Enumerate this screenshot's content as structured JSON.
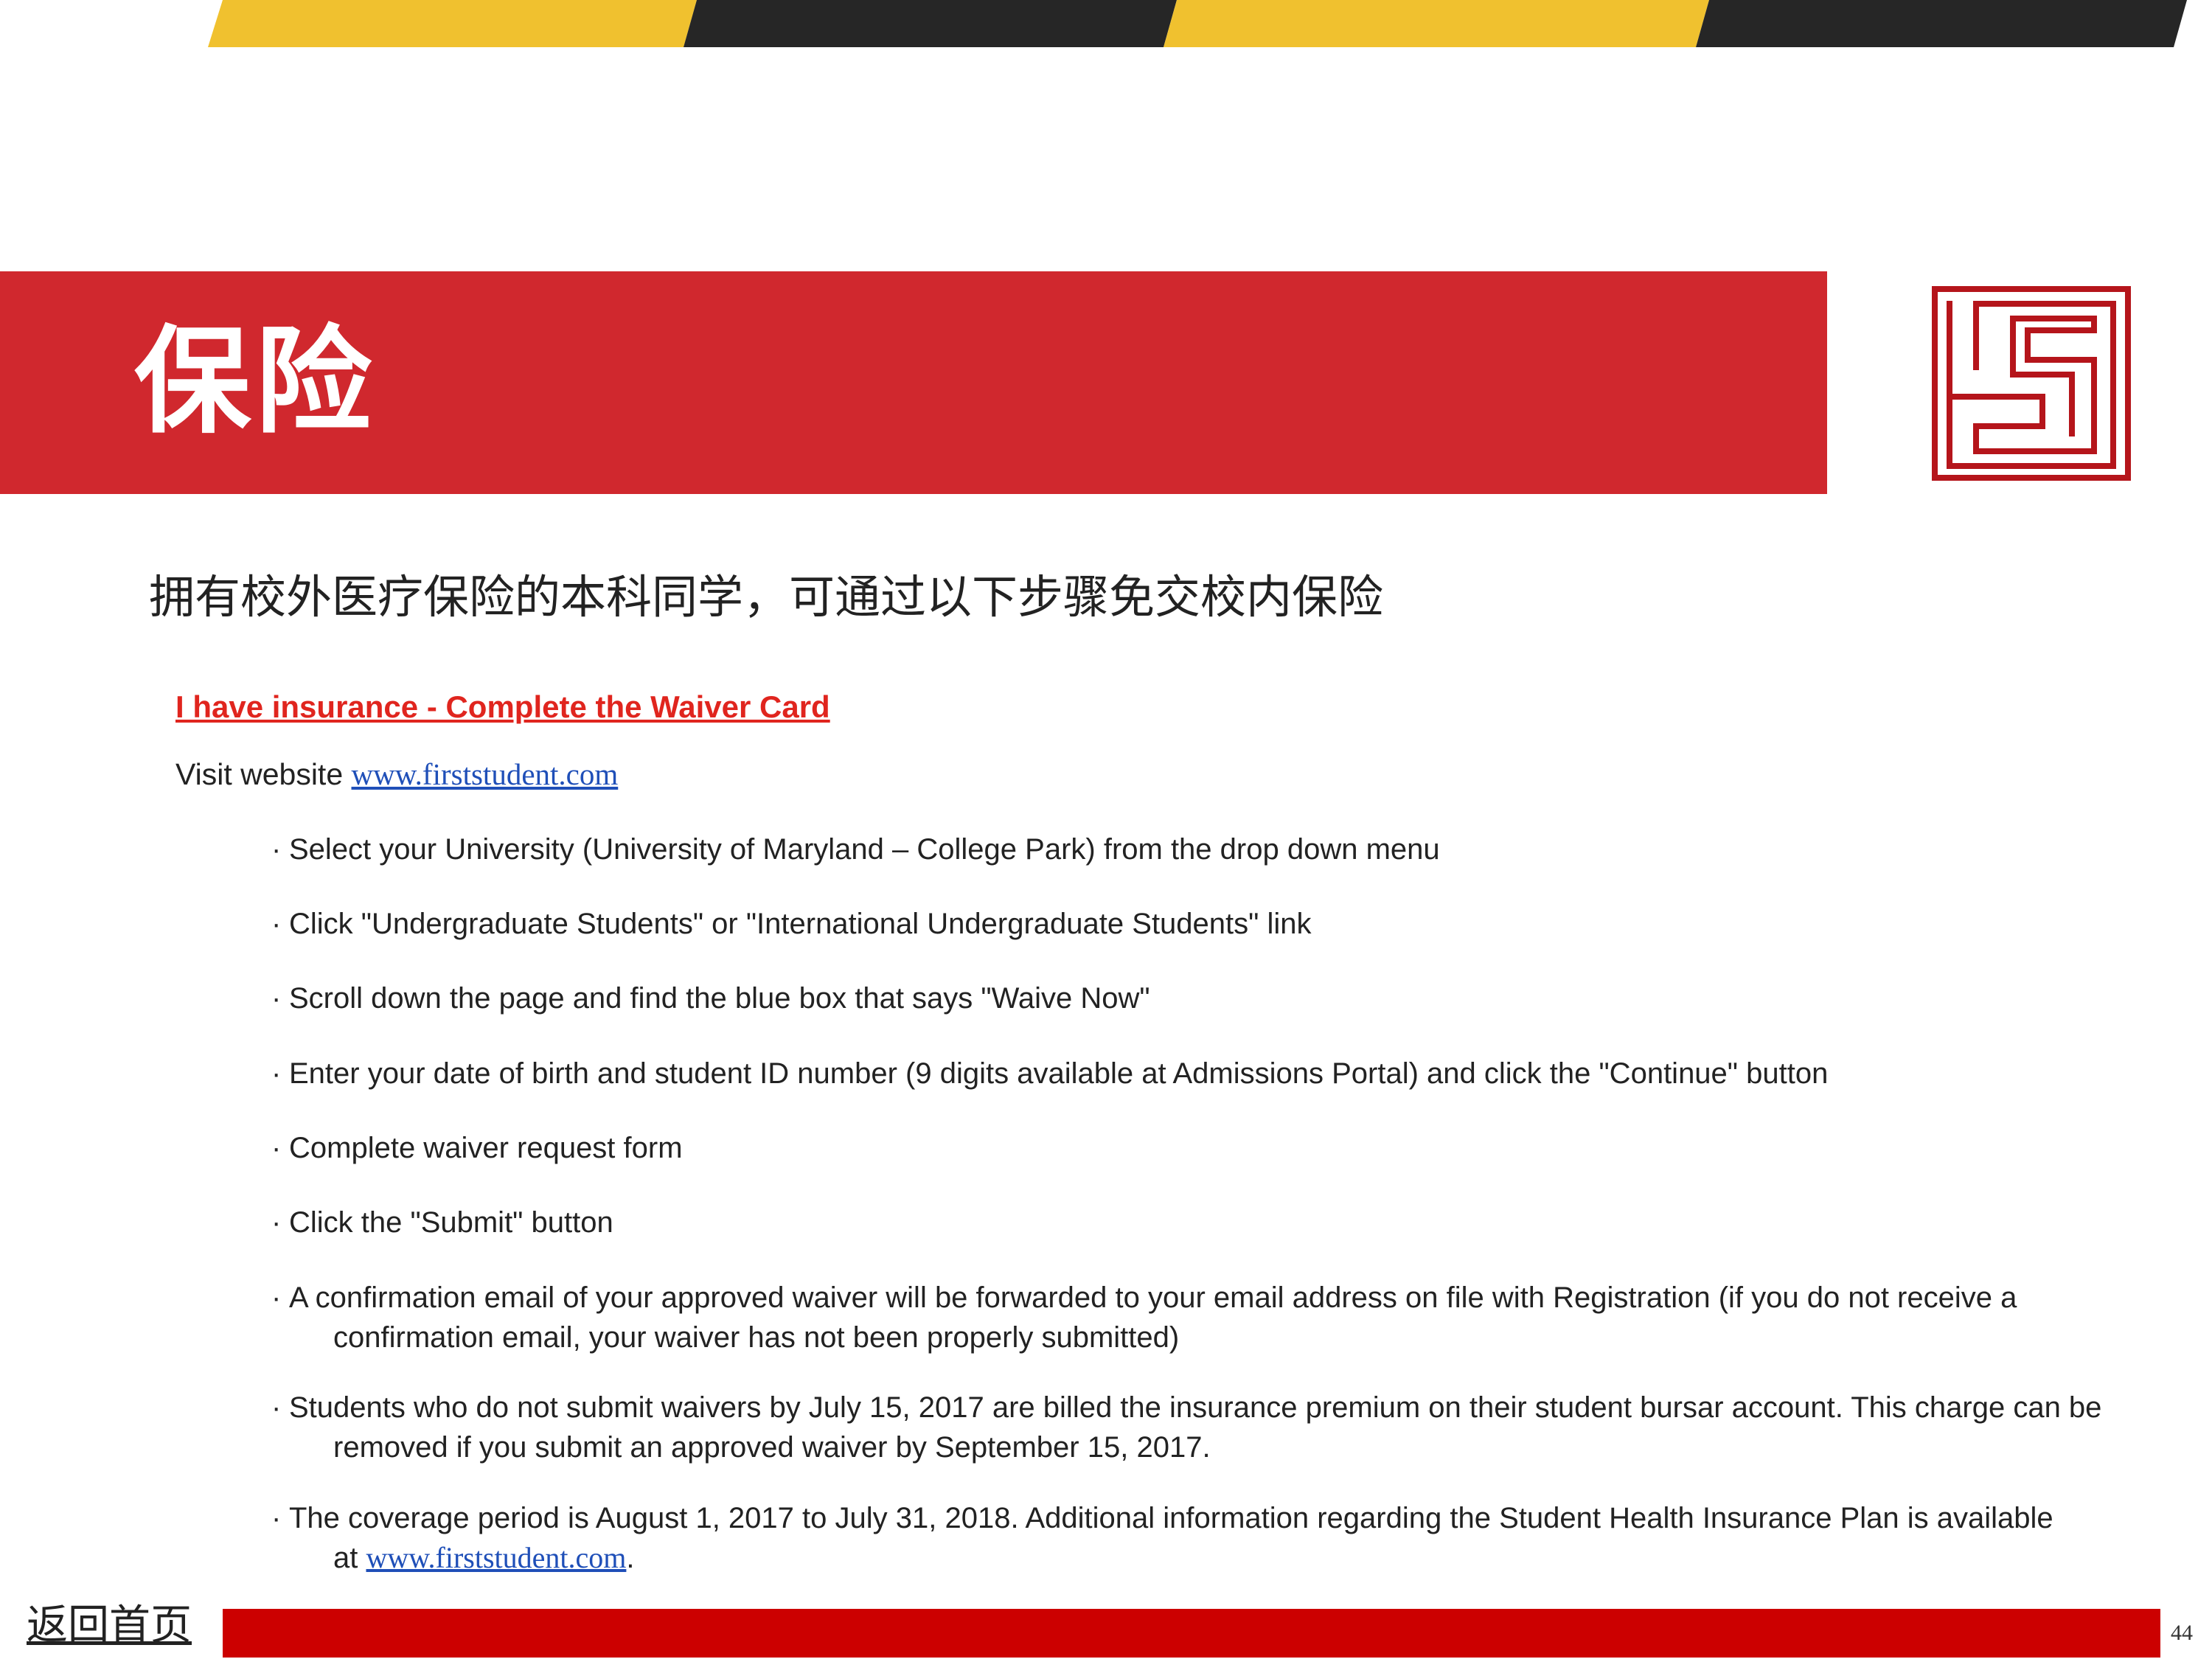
{
  "colors": {
    "banner_red": "#d0282e",
    "stripe_yellow": "#f0c12f",
    "stripe_dark": "#262626",
    "footer_red": "#cc0000",
    "heading_red": "#e0251e",
    "link_blue": "#1f4fb8"
  },
  "icons": {
    "logo": "maze-seal-logo"
  },
  "title": "保险",
  "subtitle": "拥有校外医疗保险的本科同学，可通过以下步骤免交校内保险",
  "waiver": {
    "heading": "I have insurance - Complete the Waiver Card",
    "visit_prefix": "Visit website ",
    "visit_link": "www.firststudent.com",
    "steps": [
      {
        "text": "Select your University (University of Maryland – College Park) from the drop down menu"
      },
      {
        "text": "Click \"Undergraduate Students\" or \"International Undergraduate Students\" link"
      },
      {
        "text": "Scroll down the page and find the blue box that says \"Waive Now\""
      },
      {
        "text": "Enter your date of birth and student ID number (9 digits available at Admissions Portal) and click the \"Continue\" button"
      },
      {
        "text": "Complete waiver request form"
      },
      {
        "text": "Click the \"Submit\" button"
      },
      {
        "text": "A confirmation email of your approved waiver will be forwarded to your email address on file with Registration (if you do not receive a",
        "cont": "confirmation email, your waiver has not been properly submitted)"
      },
      {
        "text": "Students who do not submit waivers by July 15, 2017 are billed the insurance premium on their student bursar account.  This charge can be",
        "cont": "removed if you submit an approved waiver by September 15, 2017."
      },
      {
        "text": "The coverage period is August 1, 2017 to July 31, 2018.  Additional information regarding the Student Health Insurance Plan is available",
        "cont_prefix": "at ",
        "cont_link": "www.firststudent.com",
        "cont_suffix": "."
      }
    ]
  },
  "footer": {
    "home_link": "返回首页",
    "page_number": "44"
  }
}
